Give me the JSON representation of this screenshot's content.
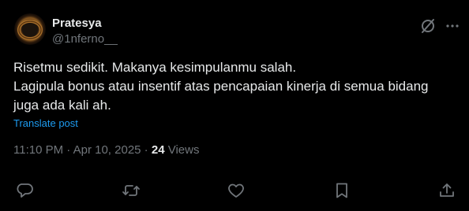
{
  "author": {
    "name": "Pratesya",
    "handle": "@1nferno__"
  },
  "tweet": {
    "lines": [
      "Risetmu sedikit. Makanya kesimpulanmu salah.",
      "Lagipula bonus atau insentif atas pencapaian kinerja di semua bidang",
      "juga ada kali ah."
    ],
    "translate_label": "Translate post",
    "time": "11:10 PM",
    "separator1": " · ",
    "date": "Apr 10, 2025",
    "separator2": " · ",
    "views_count": "24",
    "views_label": " Views"
  },
  "icons": {
    "header": [
      "grok-icon",
      "more-icon"
    ],
    "actions": [
      "reply-icon",
      "repost-icon",
      "like-icon",
      "bookmark-icon",
      "share-icon"
    ]
  },
  "colors": {
    "background": "#000000",
    "text": "#e7e9ea",
    "secondary": "#71767b",
    "link": "#1d9bf0"
  }
}
